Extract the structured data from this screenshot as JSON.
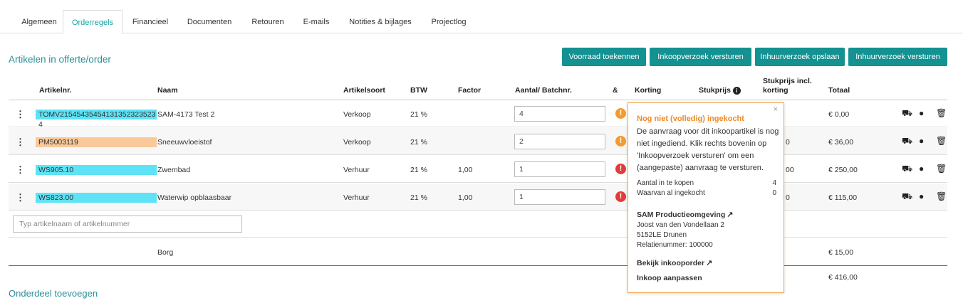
{
  "tabs": [
    "Algemeen",
    "Orderregels",
    "Financieel",
    "Documenten",
    "Retouren",
    "E-mails",
    "Notities & bijlages",
    "Projectlog"
  ],
  "active_tab": "Orderregels",
  "section_title": "Artikelen in offerte/order",
  "buttons": {
    "allocate": "Voorraad toekennen",
    "purchase_request": "Inkoopverzoek versturen",
    "rental_save": "Inhuurverzoek opslaan",
    "rental_send": "Inhuurverzoek versturen"
  },
  "columns": {
    "sku": "Artikelnr.",
    "name": "Naam",
    "type": "Artikelsoort",
    "vat": "BTW",
    "factor": "Factor",
    "qty": "Aantal/ Batchnr.",
    "amp": "&",
    "discount": "Korting",
    "unit_price": "Stukprijs",
    "unit_price_disc_1": "Stukprijs incl.",
    "unit_price_disc_2": "korting",
    "total": "Totaal"
  },
  "rows": [
    {
      "sku": "TOMV21545435454131352323523​4",
      "name": "SAM-4173 Test 2",
      "type": "Verkoop",
      "vat": "21 %",
      "factor": "",
      "qty": "4",
      "partial": "",
      "total": "€ 0,00",
      "sku_color": "#5de3f5",
      "alert": "#f59b2b"
    },
    {
      "sku": "PM5003119",
      "name": "Sneeuwvloeistof",
      "type": "Verkoop",
      "vat": "21 %",
      "factor": "",
      "qty": "2",
      "partial": "0",
      "total": "€ 36,00",
      "sku_color": "#f9c99a",
      "alert": "#f59b2b"
    },
    {
      "sku": "WS905.10",
      "name": "Zwembad",
      "type": "Verhuur",
      "vat": "21 %",
      "factor": "1,00",
      "qty": "1",
      "partial": "00",
      "total": "€ 250,00",
      "sku_color": "#5de3f5",
      "alert": "#e23b3b"
    },
    {
      "sku": "WS823.00",
      "name": "Waterwip opblaasbaar",
      "type": "Verhuur",
      "vat": "21 %",
      "factor": "1,00",
      "qty": "1",
      "partial": "0",
      "total": "€ 115,00",
      "sku_color": "#5de3f5",
      "alert": "#e23b3b"
    }
  ],
  "search_placeholder": "Typ artikelnaam of artikelnummer",
  "deposit": {
    "name": "Borg",
    "total": "€ 15,00"
  },
  "grand_total": "€ 416,00",
  "add_section": "Onderdeel toevoegen",
  "popup": {
    "close": "×",
    "title": "Nog niet (volledig) ingekocht",
    "description": "De aanvraag voor dit inkoopartikel is nog niet ingediend. Klik rechts bovenin op 'Inkoopverzoek versturen' om een (aangepaste) aanvraag te versturen.",
    "to_buy_label": "Aantal in te kopen",
    "to_buy_value": "4",
    "bought_label": "Waarvan al ingekocht",
    "bought_value": "0",
    "supplier_name": "SAM Productieomgeving",
    "supplier_address": "Joost van den Vondellaan 2",
    "supplier_city": "5152LE Drunen",
    "supplier_relation": "Relatienummer: 100000",
    "view_order": "Bekijk inkooporder",
    "edit_purchase": "Inkoop aanpassen"
  },
  "colors": {
    "accent": "#149191",
    "warning": "#f08a24",
    "error": "#e23b3b"
  }
}
